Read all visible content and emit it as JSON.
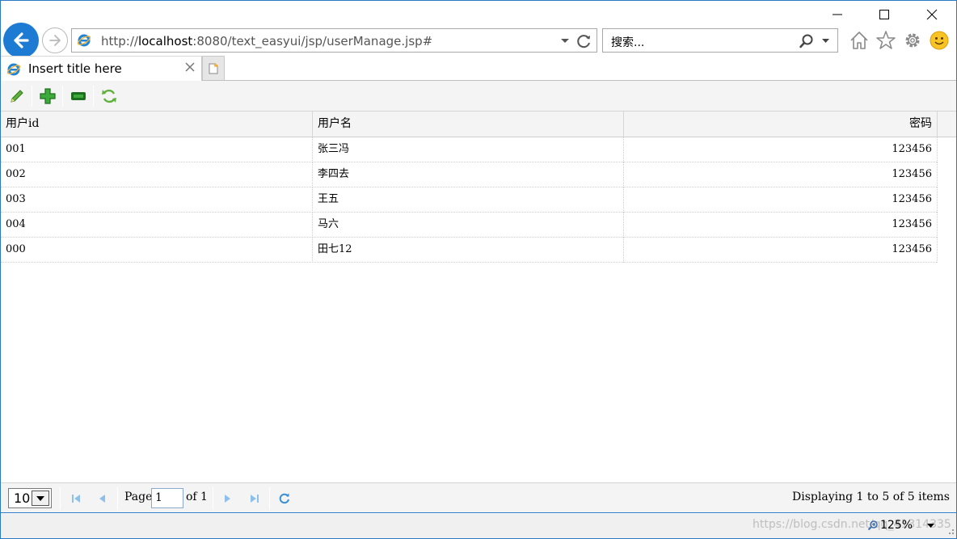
{
  "browser": {
    "address": {
      "prefix": "http://",
      "host": "localhost",
      "rest": ":8080/text_easyui/jsp/userManage.jsp#"
    },
    "search_placeholder": "搜索...",
    "zoom": "125%",
    "watermark": "https://blog.csdn.net/qq_41314335"
  },
  "tab": {
    "title": "Insert title here"
  },
  "toolbar": {
    "items": [
      {
        "icon": "edit-pencil-icon"
      },
      {
        "icon": "add-plus-icon"
      },
      {
        "icon": "remove-minus-icon"
      },
      {
        "icon": "reload-icon"
      }
    ]
  },
  "grid": {
    "columns": [
      "用户id",
      "用户名",
      "密码"
    ],
    "rows": [
      [
        "001",
        "张三冯",
        "123456"
      ],
      [
        "002",
        "李四去",
        "123456"
      ],
      [
        "003",
        "王五",
        "123456"
      ],
      [
        "004",
        "马六",
        "123456"
      ],
      [
        "000",
        "田七12",
        "123456"
      ]
    ]
  },
  "pager": {
    "page_size": "10",
    "page_label": "Page",
    "page_value": "1",
    "of_label": "of 1",
    "info": "Displaying 1 to 5 of 5 items"
  },
  "colors": {
    "accent": "#2b79c5",
    "green": "#2f9e2f",
    "pager_blue": "#3b8fd4"
  }
}
